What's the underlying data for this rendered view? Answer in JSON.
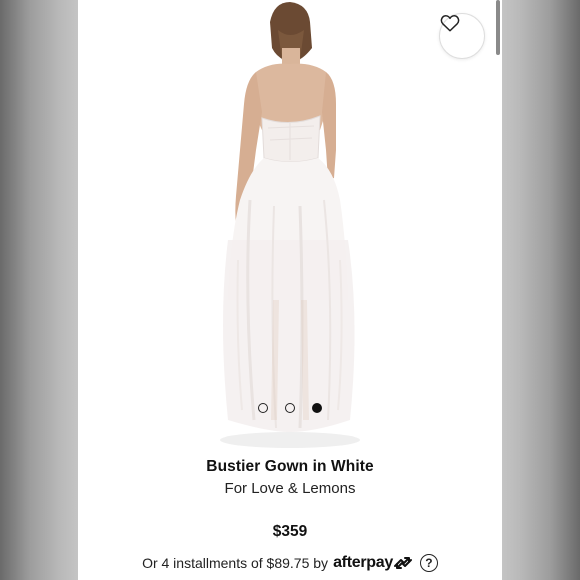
{
  "product": {
    "title": "Bustier Gown in White",
    "brand": "For Love & Lemons",
    "price": "$359"
  },
  "payment": {
    "prefix": "Or 4 installments of $89.75 by",
    "provider": "afterpay",
    "help_glyph": "?"
  },
  "gallery": {
    "image_count": 3,
    "active_index": 2,
    "image_icon": "model-in-white-gown-back-view"
  },
  "icons": {
    "favorite": "heart-outline-icon",
    "help": "question-circle-icon",
    "afterpay_mark": "afterpay-arrows-icon"
  },
  "colors": {
    "text": "#111111",
    "panel_bg": "#ffffff",
    "side_bg": "#b9b9b9"
  }
}
